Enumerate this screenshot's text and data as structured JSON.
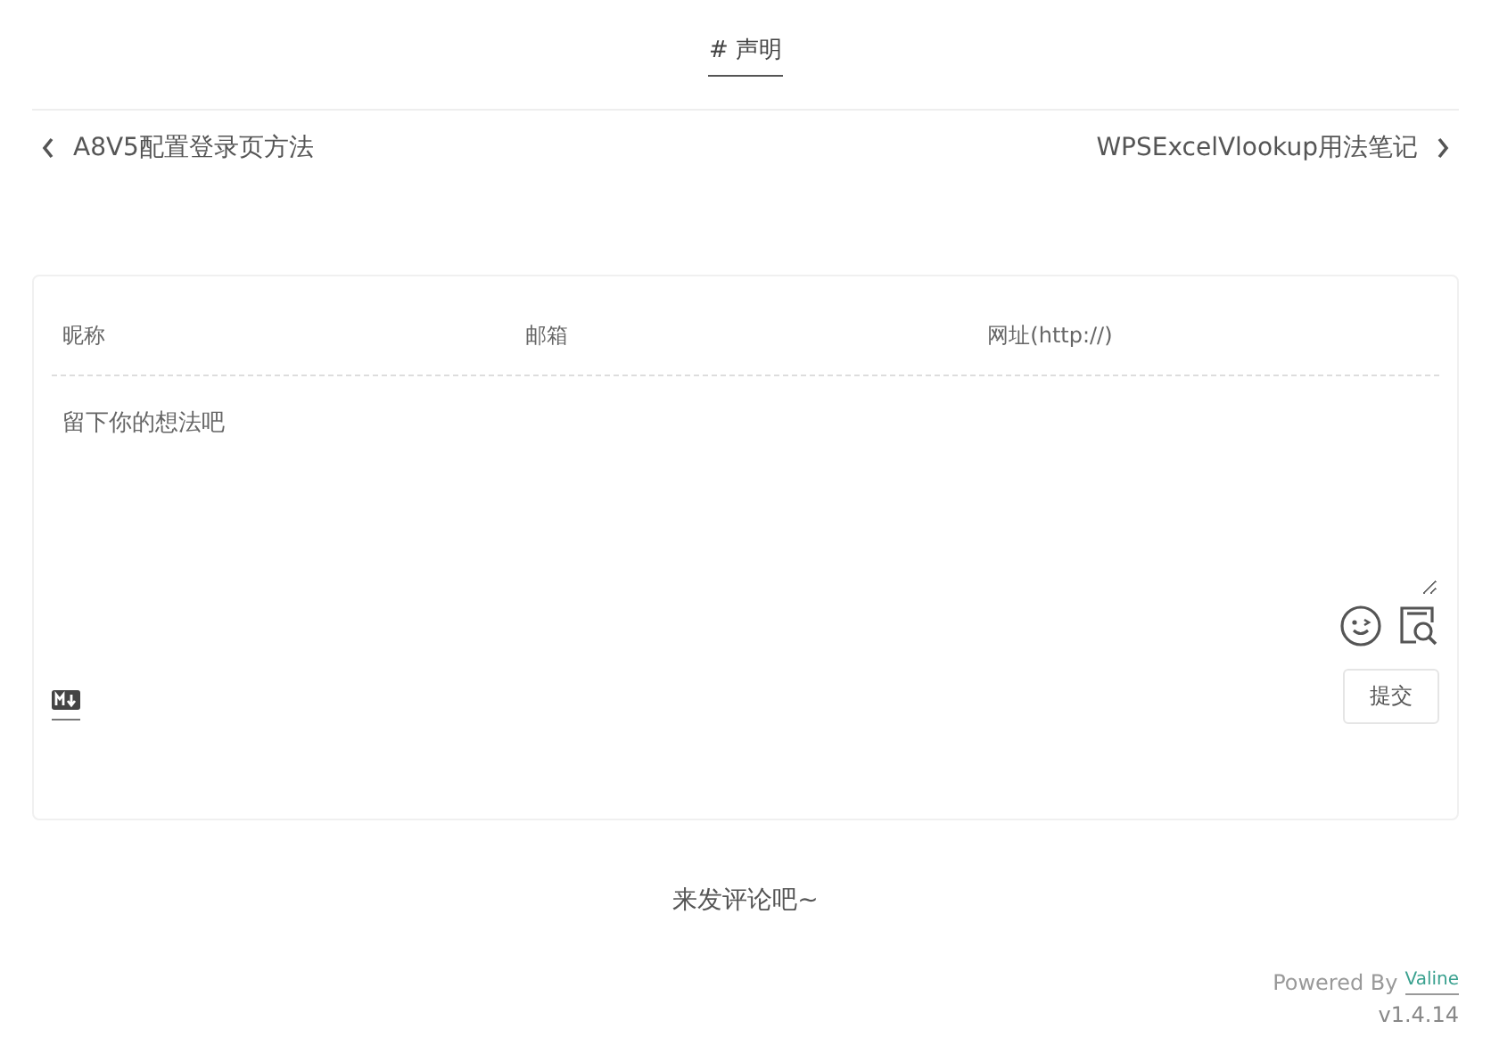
{
  "tag": "# 声明",
  "post_nav": {
    "previous": "A8V5配置登录页方法",
    "next": "WPSExcelVlookup用法笔记"
  },
  "comment_form": {
    "fields": [
      {
        "placeholder": "昵称"
      },
      {
        "placeholder": "邮箱"
      },
      {
        "placeholder": "网址(http://)"
      }
    ],
    "textarea": {
      "placeholder": "留下你的想法吧"
    },
    "submit": "提交"
  },
  "empty_message": "来发评论吧~",
  "footer": {
    "powered_by": "Powered By",
    "brand": "Valine",
    "version": "v1.4.14"
  }
}
